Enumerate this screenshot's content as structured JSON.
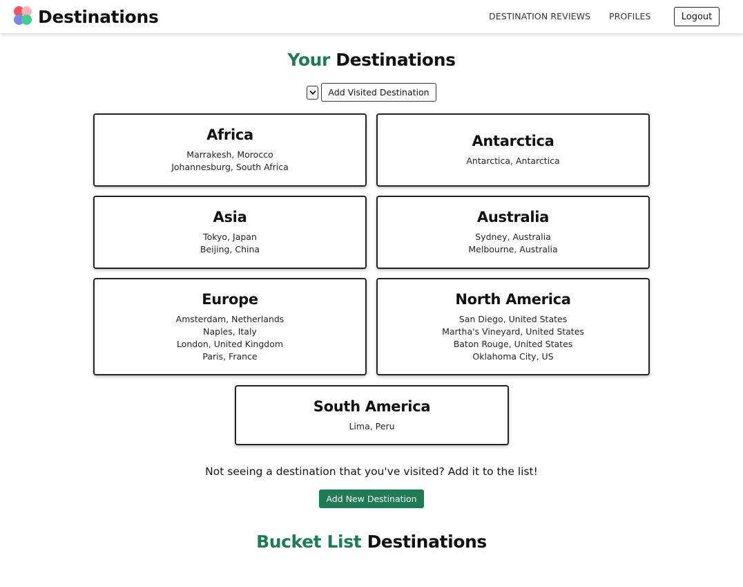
{
  "nav": {
    "brand": "Destinations",
    "links": [
      "DESTINATION REVIEWS",
      "PROFILES"
    ],
    "logout_label": "Logout"
  },
  "your_destinations": {
    "title_accent": "Your",
    "title_rest": "Destinations",
    "select_icon": "chevron-down-icon",
    "add_visited_label": "Add Visited Destination",
    "continents": [
      {
        "name": "Africa",
        "places": [
          "Marrakesh, Morocco",
          "Johannesburg, South Africa"
        ]
      },
      {
        "name": "Antarctica",
        "places": [
          "Antarctica, Antarctica"
        ]
      },
      {
        "name": "Asia",
        "places": [
          "Tokyo, Japan",
          "Beijing, China"
        ]
      },
      {
        "name": "Australia",
        "places": [
          "Sydney, Australia",
          "Melbourne, Australia"
        ]
      },
      {
        "name": "Europe",
        "places": [
          "Amsterdam, Netherlands",
          "Naples, Italy",
          "London, United Kingdom",
          "Paris, France"
        ]
      },
      {
        "name": "North America",
        "places": [
          "San Diego, United States",
          "Martha's Vineyard, United States",
          "Baton Rouge, United States",
          "Oklahoma City, US"
        ]
      },
      {
        "name": "South America",
        "places": [
          "Lima, Peru"
        ]
      }
    ]
  },
  "add_prompt": {
    "text": "Not seeing a destination that you've visited? Add it to the list!",
    "button_label": "Add New Destination"
  },
  "bucket_list": {
    "title_accent": "Bucket List",
    "title_rest": "Destinations"
  },
  "colors": {
    "accent": "#1f7a55",
    "text": "#111111",
    "logo": [
      "#ef5561",
      "#f7b3ba",
      "#7a86ea",
      "#3fcf8e"
    ]
  }
}
